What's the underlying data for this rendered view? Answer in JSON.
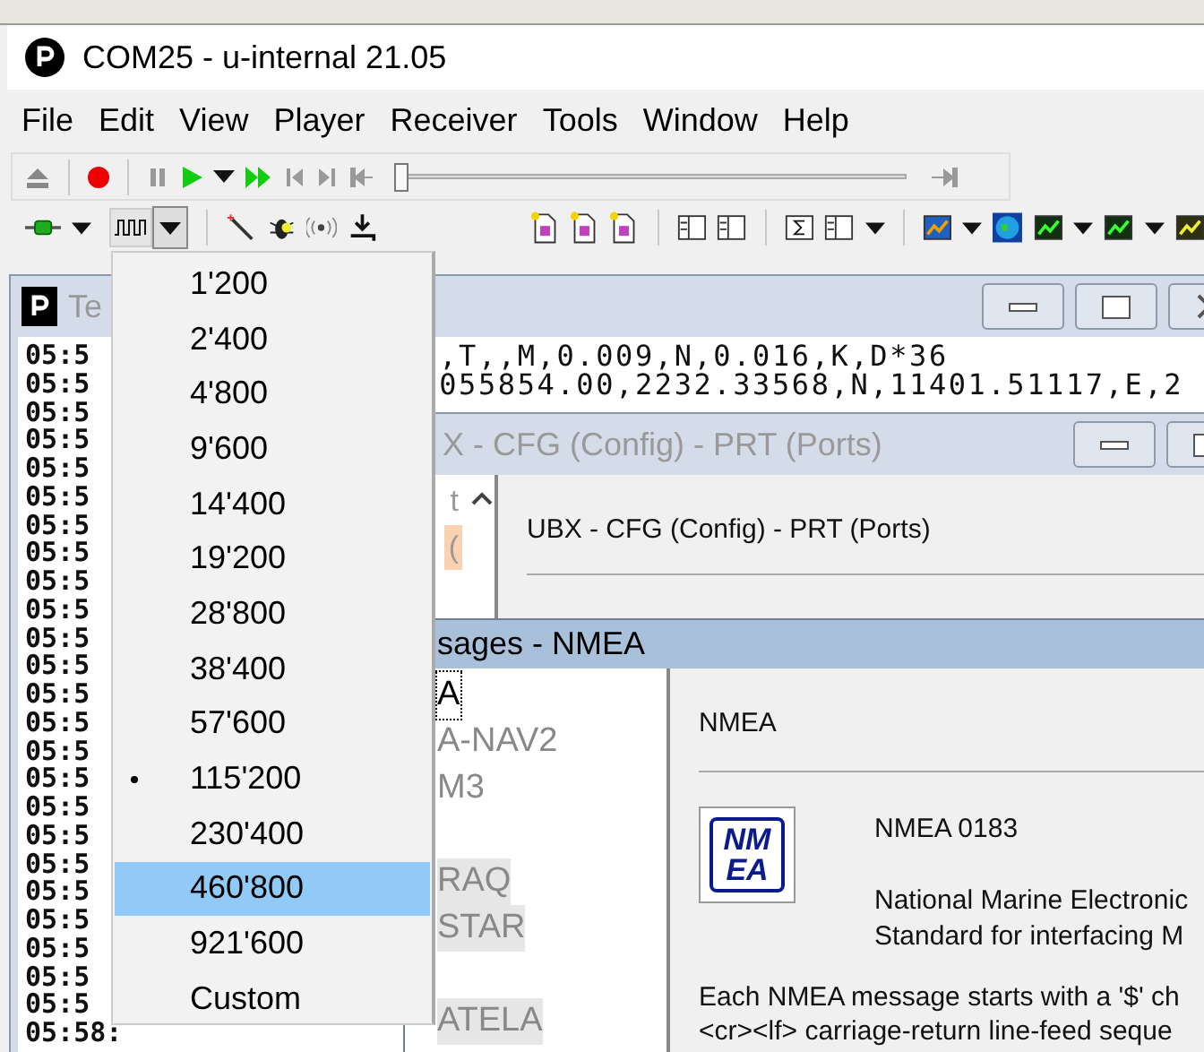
{
  "window": {
    "title": "COM25 - u-internal 21.05"
  },
  "menu": [
    "File",
    "Edit",
    "View",
    "Player",
    "Receiver",
    "Tools",
    "Window",
    "Help"
  ],
  "player": {
    "position": {
      "level": 0
    }
  },
  "text_console": {
    "title": "Te",
    "lines": [
      {
        "time": "05:5",
        "text": ",T,,M,0.009,N,0.016,K,D*36"
      },
      {
        "time": "05:5",
        "text": "055854.00,2232.33568,N,11401.51117,E,2"
      },
      {
        "time": "05:5"
      },
      {
        "time": "05:5"
      },
      {
        "time": "05:5"
      },
      {
        "time": "05:5"
      },
      {
        "time": "05:5"
      },
      {
        "time": "05:5"
      },
      {
        "time": "05:5"
      },
      {
        "time": "05:5"
      },
      {
        "time": "05:5"
      },
      {
        "time": "05:5"
      },
      {
        "time": "05:5"
      },
      {
        "time": "05:5"
      },
      {
        "time": "05:5"
      },
      {
        "time": "05:5"
      },
      {
        "time": "05:5"
      },
      {
        "time": "05:5"
      },
      {
        "time": "05:5"
      },
      {
        "time": "05:5"
      },
      {
        "time": "05:5"
      },
      {
        "time": "05:5"
      },
      {
        "time": "05:5"
      },
      {
        "time": "05:5"
      },
      {
        "time": "05:58:"
      }
    ]
  },
  "config_window": {
    "title": "X - CFG (Config) - PRT (Ports)",
    "tree_items": [
      {
        "label": "t",
        "selected": false
      },
      {
        "label": "(",
        "selected": true
      }
    ],
    "heading": "UBX - CFG (Config) - PRT (Ports)"
  },
  "messages_window": {
    "title": "sages - NMEA",
    "list_items": [
      {
        "label": "A",
        "selected": true,
        "shaded": false
      },
      {
        "label": "A-NAV2",
        "selected": false,
        "shaded": false
      },
      {
        "label": "M3",
        "selected": false,
        "shaded": false
      },
      {
        "label": "RAQ",
        "selected": false,
        "shaded": true
      },
      {
        "label": "STAR",
        "selected": false,
        "shaded": true
      },
      {
        "label": "ATELA",
        "selected": false,
        "shaded": true
      }
    ],
    "heading": "NMEA",
    "logo_lines": [
      "NM",
      "EA"
    ],
    "standard": "NMEA 0183",
    "description": [
      "National Marine Electronic",
      "Standard for interfacing M"
    ],
    "body": [
      "Each NMEA message starts with a '$' ch",
      "<cr><lf> carriage-return line-feed seque"
    ]
  },
  "baud_menu": {
    "items": [
      {
        "label": "1'200",
        "selected": false,
        "highlighted": false
      },
      {
        "label": "2'400",
        "selected": false,
        "highlighted": false
      },
      {
        "label": "4'800",
        "selected": false,
        "highlighted": false
      },
      {
        "label": "9'600",
        "selected": false,
        "highlighted": false
      },
      {
        "label": "14'400",
        "selected": false,
        "highlighted": false
      },
      {
        "label": "19'200",
        "selected": false,
        "highlighted": false
      },
      {
        "label": "28'800",
        "selected": false,
        "highlighted": false
      },
      {
        "label": "38'400",
        "selected": false,
        "highlighted": false
      },
      {
        "label": "57'600",
        "selected": false,
        "highlighted": false
      },
      {
        "label": "115'200",
        "selected": true,
        "highlighted": false
      },
      {
        "label": "230'400",
        "selected": false,
        "highlighted": false
      },
      {
        "label": "460'800",
        "selected": false,
        "highlighted": true
      },
      {
        "label": "921'600",
        "selected": false,
        "highlighted": false
      },
      {
        "label": "Custom",
        "selected": false,
        "highlighted": false
      }
    ]
  }
}
